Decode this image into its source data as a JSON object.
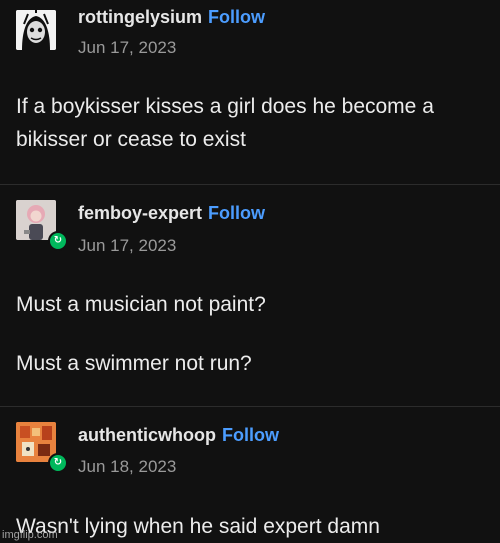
{
  "posts": [
    {
      "username": "rottingelysium",
      "follow_label": "Follow",
      "date": "Jun 17, 2023",
      "paragraphs": [
        "If a boykisser kisses a girl does he become a bikisser or cease to exist"
      ]
    },
    {
      "username": "femboy-expert",
      "follow_label": "Follow",
      "date": "Jun 17, 2023",
      "paragraphs": [
        "Must a musician not paint?",
        "Must a swimmer not run?"
      ]
    },
    {
      "username": "authenticwhoop",
      "follow_label": "Follow",
      "date": "Jun 18, 2023",
      "paragraphs": [
        "Wasn't lying when he said expert damn"
      ]
    }
  ],
  "watermark": "imgflip.com",
  "colors": {
    "background": "#111111",
    "follow": "#4c9dff",
    "reblog_badge": "#00b85c"
  }
}
